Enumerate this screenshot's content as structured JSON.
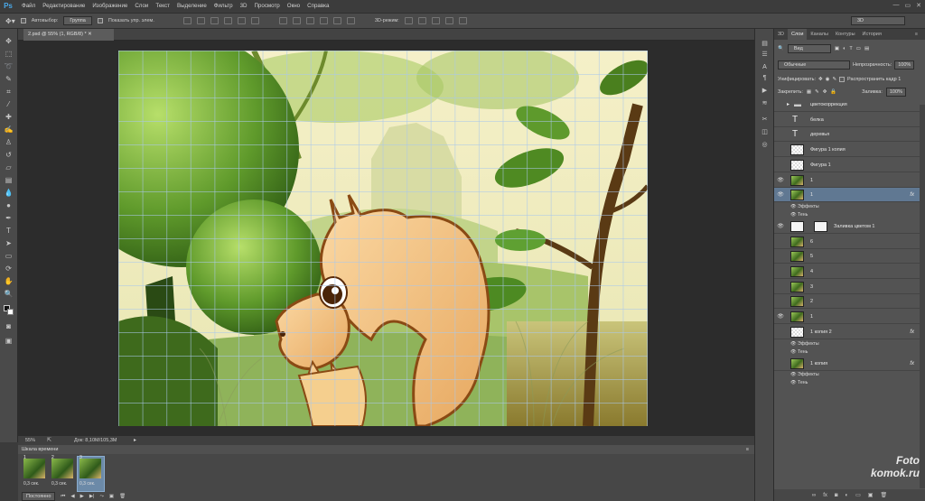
{
  "app": {
    "logo": "Ps"
  },
  "menu": [
    "Файл",
    "Редактирование",
    "Изображение",
    "Слои",
    "Текст",
    "Выделение",
    "Фильтр",
    "3D",
    "Просмотр",
    "Окно",
    "Справка"
  ],
  "options": {
    "autoselect_label": "Автовыбор:",
    "autoselect_value": "Группа",
    "show_controls_label": "Показать упр. элем.",
    "mode3d_label": "3D-режим:",
    "workspace": "3D"
  },
  "document": {
    "tab_title": "2.psd @ 55% (1, RGB/8) *",
    "zoom": "55%",
    "doc_size": "Док: 8,10M/105,3M"
  },
  "timeline": {
    "title": "Шкала времени",
    "frames": [
      {
        "num": "1",
        "duration": "0,3 сек.",
        "selected": false
      },
      {
        "num": "2",
        "duration": "0,3 сек.",
        "selected": false
      },
      {
        "num": "3",
        "duration": "0,3 сек.",
        "selected": true
      }
    ],
    "loop": "Постоянно"
  },
  "panel": {
    "tabs": [
      "3D",
      "Слои",
      "Каналы",
      "Контуры",
      "История"
    ],
    "active_tab": "Слои",
    "filter": "Вид",
    "blend_mode": "Обычные",
    "opacity_label": "Непрозрачность:",
    "opacity": "100%",
    "unify_label": "Унифицировать:",
    "propagate_label": "Распространить кадр 1",
    "lock_label": "Закрепить:",
    "fill_label": "Заливка:",
    "fill": "100%",
    "layers": [
      {
        "name": "цветокоррекция",
        "kind": "folder",
        "eye": false
      },
      {
        "name": "белка",
        "kind": "text",
        "eye": false
      },
      {
        "name": "деревья",
        "kind": "text",
        "eye": false
      },
      {
        "name": "Фигура 1 копия",
        "kind": "checker",
        "eye": false
      },
      {
        "name": "Фигура 1",
        "kind": "checker",
        "eye": false
      },
      {
        "name": "1",
        "kind": "img",
        "eye": true
      },
      {
        "name": "1",
        "kind": "img",
        "eye": true,
        "selected": true,
        "fx": "fx",
        "effects": [
          "Эффекты",
          "Тень"
        ]
      },
      {
        "name": "Заливка цветом 1",
        "kind": "white",
        "eye": true
      },
      {
        "name": "6",
        "kind": "img",
        "eye": false
      },
      {
        "name": "5",
        "kind": "img",
        "eye": false
      },
      {
        "name": "4",
        "kind": "img",
        "eye": false
      },
      {
        "name": "3",
        "kind": "img",
        "eye": false
      },
      {
        "name": "2",
        "kind": "img",
        "eye": false
      },
      {
        "name": "1",
        "kind": "img",
        "eye": true
      },
      {
        "name": "1 копия 2",
        "kind": "checker",
        "eye": false,
        "fx": "fx",
        "effects": [
          "Эффекты",
          "Тень"
        ]
      },
      {
        "name": "1 копия",
        "kind": "img",
        "eye": false,
        "fx": "fx",
        "effects": [
          "Эффекты",
          "Тень"
        ]
      }
    ]
  },
  "watermark": {
    "line1": "Foto",
    "line2": "komok.ru"
  }
}
